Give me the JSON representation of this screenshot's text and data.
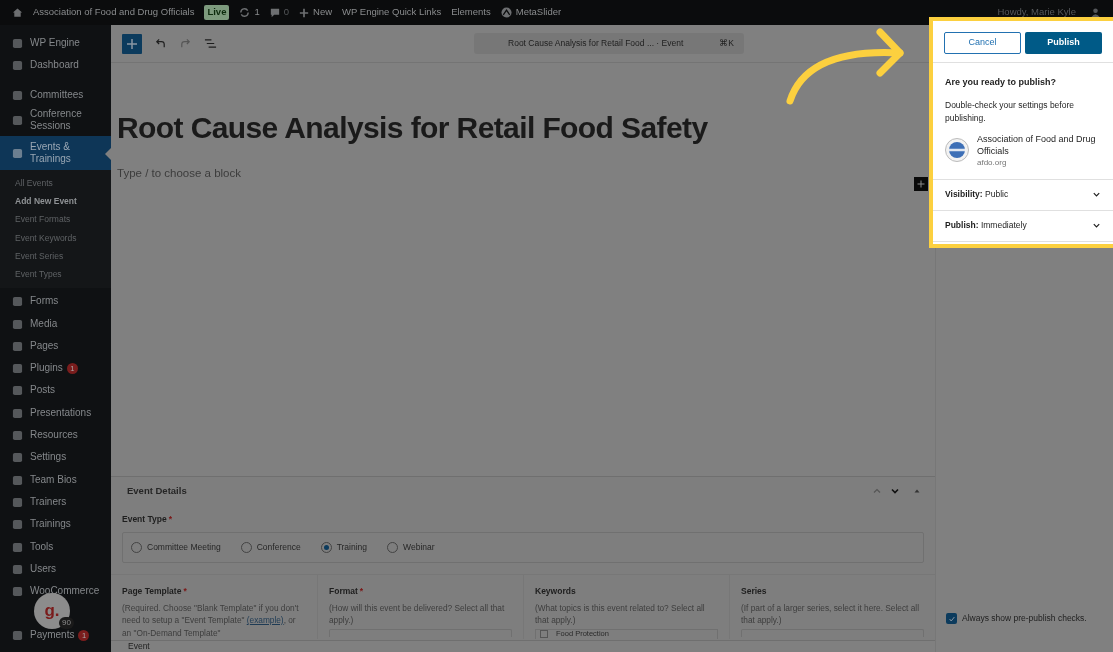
{
  "admin_bar": {
    "site": "Association of Food and Drug Officials",
    "live_badge": "Live",
    "updates": "1",
    "comments": "0",
    "new": "New",
    "links": [
      "WP Engine Quick Links",
      "Elements",
      "MetaSlider"
    ],
    "greeting": "Howdy, Marie Kyle"
  },
  "sidebar": {
    "groups": [
      [
        {
          "label": "WP Engine",
          "selected": false
        },
        {
          "label": "Dashboard",
          "selected": false
        }
      ],
      [
        {
          "label": "Committees",
          "selected": false
        },
        {
          "label": "Conference Sessions",
          "selected": false
        },
        {
          "label": "Events & Trainings",
          "selected": true,
          "children": [
            {
              "label": "All Events",
              "selected": false
            },
            {
              "label": "Add New Event",
              "selected": true
            },
            {
              "label": "Event Formats",
              "selected": false
            },
            {
              "label": "Event Keywords",
              "selected": false
            },
            {
              "label": "Event Series",
              "selected": false
            },
            {
              "label": "Event Types",
              "selected": false
            }
          ]
        },
        {
          "label": "Forms",
          "selected": false
        },
        {
          "label": "Media",
          "selected": false
        },
        {
          "label": "Pages",
          "selected": false
        },
        {
          "label": "Plugins",
          "selected": false,
          "badge": "1"
        },
        {
          "label": "Posts",
          "selected": false
        },
        {
          "label": "Presentations",
          "selected": false
        },
        {
          "label": "Resources",
          "selected": false
        },
        {
          "label": "Settings",
          "selected": false
        },
        {
          "label": "Team Bios",
          "selected": false
        },
        {
          "label": "Trainers",
          "selected": false
        },
        {
          "label": "Trainings",
          "selected": false
        },
        {
          "label": "Tools",
          "selected": false
        },
        {
          "label": "Users",
          "selected": false
        },
        {
          "label": "WooCommerce",
          "selected": false
        }
      ],
      [
        {
          "label": "Payments",
          "selected": false,
          "badge": "1"
        }
      ]
    ]
  },
  "editor": {
    "document_title": "Root Cause Analysis for Retail Food ... · Event",
    "shortcut": "⌘K",
    "post_title": "Root Cause Analysis for Retail Food Safety",
    "block_placeholder": "Type / to choose a block"
  },
  "event_details": {
    "title": "Event Details",
    "event_type": {
      "label": "Event Type",
      "required_mark": "*",
      "options": [
        {
          "label": "Committee Meeting",
          "selected": false
        },
        {
          "label": "Conference",
          "selected": false
        },
        {
          "label": "Training",
          "selected": true
        },
        {
          "label": "Webinar",
          "selected": false
        }
      ]
    },
    "columns": [
      {
        "title": "Page Template",
        "required_mark": "*",
        "description": "(Required. Choose \"Blank Template\" if you don't need to setup a \"Event Template\"",
        "link": "(example)",
        "description_after": ", or an \"On-Demand Template\""
      },
      {
        "title": "Format",
        "required_mark": "*",
        "description": "(How will this event be delivered? Select all that apply.)"
      },
      {
        "title": "Keywords",
        "description": "(What topics is this event related to? Select all that apply.)",
        "first_option": {
          "label": "Food Protection",
          "checked": false
        }
      },
      {
        "title": "Series",
        "description": "(If part of a larger series, select it here. Select all that apply.)"
      }
    ]
  },
  "footer": {
    "breadcrumb": "Event"
  },
  "chat_bubble": {
    "letter": "g.",
    "count": "90"
  },
  "publish_panel": {
    "cancel": "Cancel",
    "publish": "Publish",
    "heading": "Are you ready to publish?",
    "message": "Double-check your settings before publishing.",
    "site_name": "Association of Food and Drug Officials",
    "site_url": "afdo.org",
    "rows": [
      {
        "label": "Visibility:",
        "value": "Public"
      },
      {
        "label": "Publish:",
        "value": "Immediately"
      }
    ]
  },
  "prepublish_checkbox": {
    "label": "Always show pre-publish checks.",
    "checked": true
  }
}
